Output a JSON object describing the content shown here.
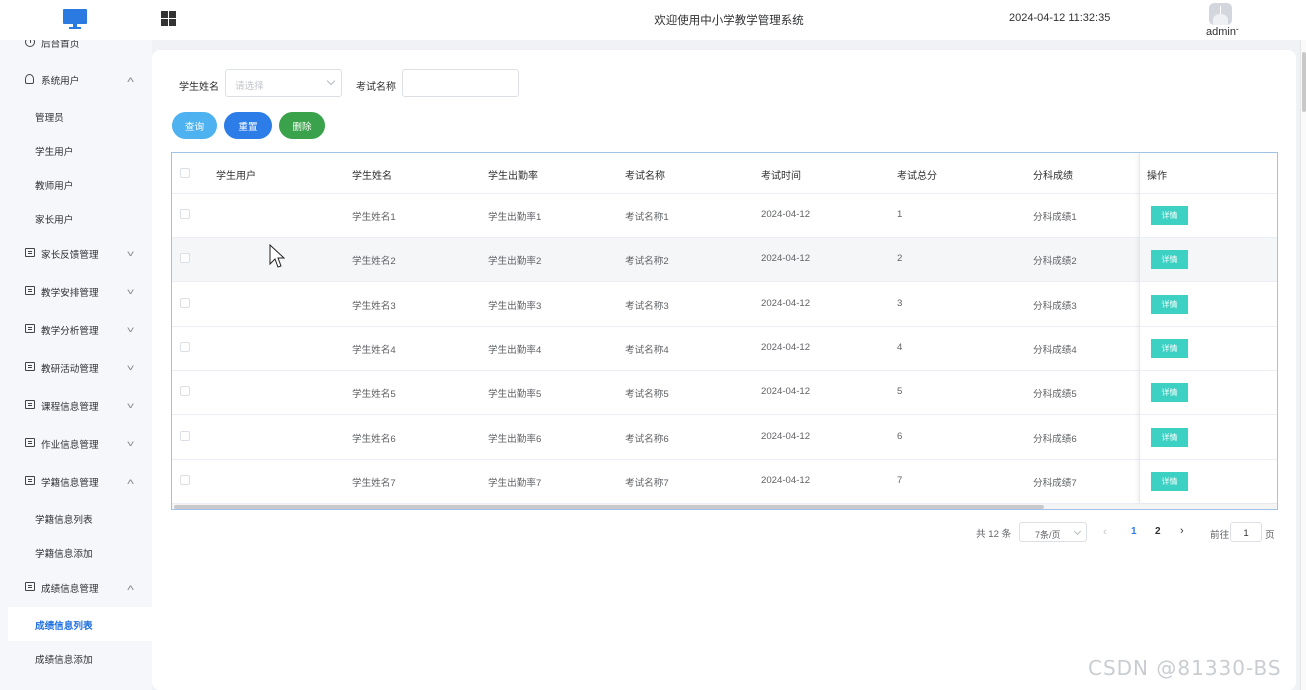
{
  "header": {
    "title": "欢迎使用中小学教学管理系统",
    "datetime": "2024-04-12 11:32:35",
    "user": "admin"
  },
  "sidebar": {
    "home": "后台首页",
    "groups": [
      {
        "label": "系统用户",
        "expanded": true,
        "items": [
          "管理员",
          "学生用户",
          "教师用户",
          "家长用户"
        ]
      },
      {
        "label": "家长反馈管理",
        "expanded": false
      },
      {
        "label": "教学安排管理",
        "expanded": false
      },
      {
        "label": "教学分析管理",
        "expanded": false
      },
      {
        "label": "教研活动管理",
        "expanded": false
      },
      {
        "label": "课程信息管理",
        "expanded": false
      },
      {
        "label": "作业信息管理",
        "expanded": false
      },
      {
        "label": "学籍信息管理",
        "expanded": true,
        "items": [
          "学籍信息列表",
          "学籍信息添加"
        ]
      },
      {
        "label": "成绩信息管理",
        "expanded": true,
        "items": [
          "成绩信息列表",
          "成绩信息添加"
        ]
      }
    ],
    "active_item": "成绩信息列表"
  },
  "filters": {
    "student_name_label": "学生姓名",
    "student_name_placeholder": "请选择",
    "exam_name_label": "考试名称",
    "exam_name_value": ""
  },
  "buttons": {
    "query": "查询",
    "reset": "重置",
    "delete": "删除"
  },
  "table": {
    "columns": [
      "学生用户",
      "学生姓名",
      "学生出勤率",
      "考试名称",
      "考试时间",
      "考试总分",
      "分科成绩",
      "操作"
    ],
    "rows": [
      [
        "",
        "学生姓名1",
        "学生出勤率1",
        "考试名称1",
        "2024-04-12",
        "1",
        "分科成绩1"
      ],
      [
        "",
        "学生姓名2",
        "学生出勤率2",
        "考试名称2",
        "2024-04-12",
        "2",
        "分科成绩2"
      ],
      [
        "",
        "学生姓名3",
        "学生出勤率3",
        "考试名称3",
        "2024-04-12",
        "3",
        "分科成绩3"
      ],
      [
        "",
        "学生姓名4",
        "学生出勤率4",
        "考试名称4",
        "2024-04-12",
        "4",
        "分科成绩4"
      ],
      [
        "",
        "学生姓名5",
        "学生出勤率5",
        "考试名称5",
        "2024-04-12",
        "5",
        "分科成绩5"
      ],
      [
        "",
        "学生姓名6",
        "学生出勤率6",
        "考试名称6",
        "2024-04-12",
        "6",
        "分科成绩6"
      ],
      [
        "",
        "学生姓名7",
        "学生出勤率7",
        "考试名称7",
        "2024-04-12",
        "7",
        "分科成绩7"
      ]
    ],
    "detail_label": "详情"
  },
  "pagination": {
    "total": "共 12 条",
    "page_size": "7条/页",
    "pages": [
      "1",
      "2"
    ],
    "current_page": "1",
    "goto_label": "前往",
    "goto_value": "1",
    "page_suffix": "页"
  },
  "watermark": "CSDN @81330-BS",
  "colors": {
    "query_button": "#4fb2f0",
    "reset_button": "#2d7de8",
    "delete_button": "#3aa24a",
    "detail_button": "#3dd1c4",
    "active_menu": "#1f6fe0"
  }
}
